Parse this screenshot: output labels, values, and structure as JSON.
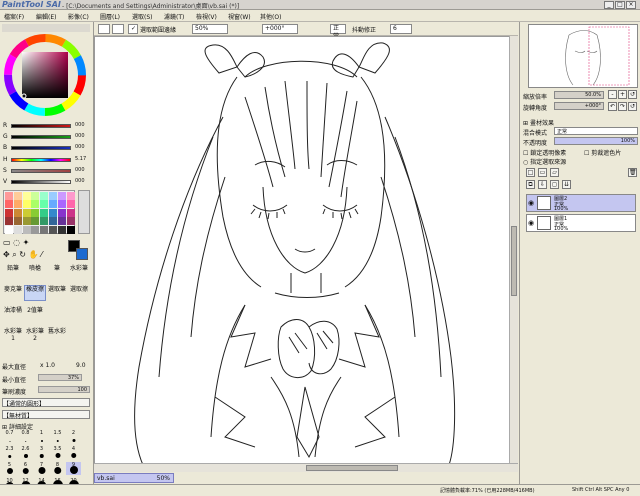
{
  "window": {
    "logo": "PaintTool SAI",
    "path": "- [C:\\Documents and Settings\\Administrator\\桌面\\vb.sai (*)]",
    "min": "_",
    "max": "□",
    "close": "×"
  },
  "menu": [
    "檔案(F)",
    "編輯(E)",
    "影像(C)",
    "圖層(L)",
    "選取(S)",
    "濾鏡(T)",
    "檢視(V)",
    "視窗(W)",
    "其他(O)"
  ],
  "toolbar": {
    "select_layer_edge": "選取範圍邊緣",
    "zoom": "50%",
    "angle": "+000°",
    "mode": "正常",
    "stabilizer_label": "抖動修正",
    "stabilizer": "6"
  },
  "color": {
    "sliders": [
      {
        "label": "R",
        "value": "000",
        "color": "#d01818"
      },
      {
        "label": "G",
        "value": "000",
        "color": "#18a018"
      },
      {
        "label": "B",
        "value": "000",
        "color": "#1830c0"
      },
      {
        "label": "H",
        "value": "5.17",
        "color": "#c000c0"
      },
      {
        "label": "S",
        "value": "000",
        "color": "#a04040"
      },
      {
        "label": "V",
        "value": "000",
        "color": "#404040"
      }
    ],
    "swatches": [
      "#ff9999",
      "#ffcc99",
      "#ffff99",
      "#ccff99",
      "#99ffcc",
      "#99ccff",
      "#cc99ff",
      "#ff99cc",
      "#ff6666",
      "#ffaa66",
      "#ffff66",
      "#aaff66",
      "#66ffaa",
      "#66aaff",
      "#aa66ff",
      "#ff66aa",
      "#cc3333",
      "#cc8833",
      "#cccc33",
      "#88cc33",
      "#33cc88",
      "#3388cc",
      "#8833cc",
      "#cc3388",
      "#993333",
      "#996633",
      "#999933",
      "#669933",
      "#339966",
      "#336699",
      "#663399",
      "#993366",
      "#ffffff",
      "#dddddd",
      "#bbbbbb",
      "#999999",
      "#777777",
      "#555555",
      "#333333",
      "#000000"
    ],
    "primary": "#000000",
    "secondary": "#ffffff"
  },
  "tools": [
    {
      "label": "鉛筆",
      "sel": false
    },
    {
      "label": "噴槍",
      "sel": false
    },
    {
      "label": "筆",
      "sel": false
    },
    {
      "label": "水彩筆",
      "sel": false
    },
    {
      "label": "麥克筆",
      "sel": false
    },
    {
      "label": "橡皮擦",
      "sel": true
    },
    {
      "label": "選取筆",
      "sel": false
    },
    {
      "label": "選取擦",
      "sel": false
    },
    {
      "label": "油漆桶",
      "sel": false
    },
    {
      "label": "2值筆",
      "sel": false
    },
    {
      "label": "",
      "sel": false
    },
    {
      "label": "",
      "sel": false
    },
    {
      "label": "水彩筆1",
      "sel": false
    },
    {
      "label": "水彩筆2",
      "sel": false
    },
    {
      "label": "舊水彩",
      "sel": false
    },
    {
      "label": "",
      "sel": false
    }
  ],
  "brush": {
    "size_label": "最大直徑",
    "size_mult": "x 1.0",
    "size": "9.0",
    "min_label": "最小直徑",
    "min": "37%",
    "density_label": "筆刷濃度",
    "density": "100",
    "shape": "【通常的圓形】",
    "texture": "【無材質】",
    "advanced": "詳細設定"
  },
  "sizes": [
    "0.7",
    "0.8",
    "1",
    "1.5",
    "2",
    "2.3",
    "2.6",
    "3",
    "3.5",
    "4",
    "5",
    "6",
    "7",
    "8",
    "9",
    "10",
    "12",
    "14",
    "16",
    "20"
  ],
  "document": {
    "name": "vb.sai",
    "zoom": "50%"
  },
  "navigator": {
    "zoom_label": "縮放倍率",
    "zoom": "50.0%",
    "angle_label": "旋轉角度",
    "angle": "+000°"
  },
  "layer_panel": {
    "effect_label": "畫材效果",
    "blend_label": "混合模式",
    "blend": "正常",
    "opacity_label": "不透明度",
    "opacity": "100%",
    "keep_alpha": "鎖定透明像素",
    "clip": "剪裁遮色片",
    "select_source": "指定選取來源",
    "layers": [
      {
        "name": "圖層2",
        "mode": "正常",
        "opacity": "100%",
        "sel": true
      },
      {
        "name": "圖層1",
        "mode": "正常",
        "opacity": "100%",
        "sel": false
      }
    ]
  },
  "status": {
    "memory": "記憶體負載率:71% (已用228MB/416MB)",
    "keys": "Shift Ctrl Alt SPC Any 0"
  }
}
